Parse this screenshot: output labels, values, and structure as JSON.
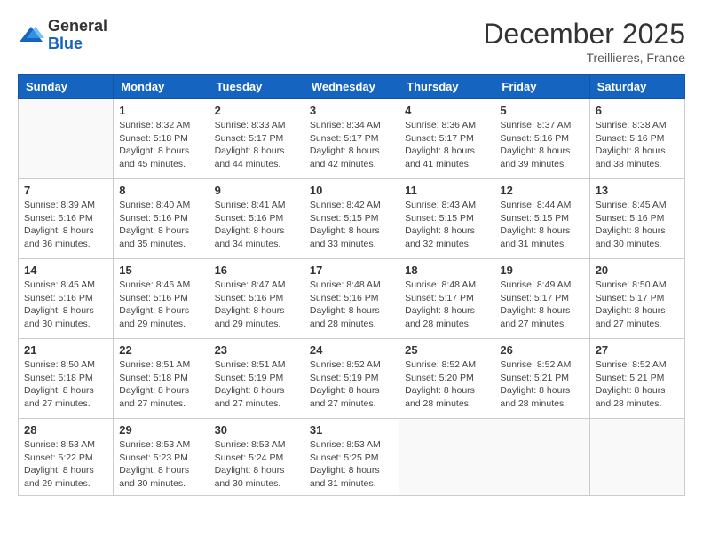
{
  "header": {
    "logo_general": "General",
    "logo_blue": "Blue",
    "month_title": "December 2025",
    "subtitle": "Treillieres, France"
  },
  "days_of_week": [
    "Sunday",
    "Monday",
    "Tuesday",
    "Wednesday",
    "Thursday",
    "Friday",
    "Saturday"
  ],
  "weeks": [
    [
      {
        "day": "",
        "info": ""
      },
      {
        "day": "1",
        "info": "Sunrise: 8:32 AM\nSunset: 5:18 PM\nDaylight: 8 hours\nand 45 minutes."
      },
      {
        "day": "2",
        "info": "Sunrise: 8:33 AM\nSunset: 5:17 PM\nDaylight: 8 hours\nand 44 minutes."
      },
      {
        "day": "3",
        "info": "Sunrise: 8:34 AM\nSunset: 5:17 PM\nDaylight: 8 hours\nand 42 minutes."
      },
      {
        "day": "4",
        "info": "Sunrise: 8:36 AM\nSunset: 5:17 PM\nDaylight: 8 hours\nand 41 minutes."
      },
      {
        "day": "5",
        "info": "Sunrise: 8:37 AM\nSunset: 5:16 PM\nDaylight: 8 hours\nand 39 minutes."
      },
      {
        "day": "6",
        "info": "Sunrise: 8:38 AM\nSunset: 5:16 PM\nDaylight: 8 hours\nand 38 minutes."
      }
    ],
    [
      {
        "day": "7",
        "info": "Sunrise: 8:39 AM\nSunset: 5:16 PM\nDaylight: 8 hours\nand 36 minutes."
      },
      {
        "day": "8",
        "info": "Sunrise: 8:40 AM\nSunset: 5:16 PM\nDaylight: 8 hours\nand 35 minutes."
      },
      {
        "day": "9",
        "info": "Sunrise: 8:41 AM\nSunset: 5:16 PM\nDaylight: 8 hours\nand 34 minutes."
      },
      {
        "day": "10",
        "info": "Sunrise: 8:42 AM\nSunset: 5:15 PM\nDaylight: 8 hours\nand 33 minutes."
      },
      {
        "day": "11",
        "info": "Sunrise: 8:43 AM\nSunset: 5:15 PM\nDaylight: 8 hours\nand 32 minutes."
      },
      {
        "day": "12",
        "info": "Sunrise: 8:44 AM\nSunset: 5:15 PM\nDaylight: 8 hours\nand 31 minutes."
      },
      {
        "day": "13",
        "info": "Sunrise: 8:45 AM\nSunset: 5:16 PM\nDaylight: 8 hours\nand 30 minutes."
      }
    ],
    [
      {
        "day": "14",
        "info": "Sunrise: 8:45 AM\nSunset: 5:16 PM\nDaylight: 8 hours\nand 30 minutes."
      },
      {
        "day": "15",
        "info": "Sunrise: 8:46 AM\nSunset: 5:16 PM\nDaylight: 8 hours\nand 29 minutes."
      },
      {
        "day": "16",
        "info": "Sunrise: 8:47 AM\nSunset: 5:16 PM\nDaylight: 8 hours\nand 29 minutes."
      },
      {
        "day": "17",
        "info": "Sunrise: 8:48 AM\nSunset: 5:16 PM\nDaylight: 8 hours\nand 28 minutes."
      },
      {
        "day": "18",
        "info": "Sunrise: 8:48 AM\nSunset: 5:17 PM\nDaylight: 8 hours\nand 28 minutes."
      },
      {
        "day": "19",
        "info": "Sunrise: 8:49 AM\nSunset: 5:17 PM\nDaylight: 8 hours\nand 27 minutes."
      },
      {
        "day": "20",
        "info": "Sunrise: 8:50 AM\nSunset: 5:17 PM\nDaylight: 8 hours\nand 27 minutes."
      }
    ],
    [
      {
        "day": "21",
        "info": "Sunrise: 8:50 AM\nSunset: 5:18 PM\nDaylight: 8 hours\nand 27 minutes."
      },
      {
        "day": "22",
        "info": "Sunrise: 8:51 AM\nSunset: 5:18 PM\nDaylight: 8 hours\nand 27 minutes."
      },
      {
        "day": "23",
        "info": "Sunrise: 8:51 AM\nSunset: 5:19 PM\nDaylight: 8 hours\nand 27 minutes."
      },
      {
        "day": "24",
        "info": "Sunrise: 8:52 AM\nSunset: 5:19 PM\nDaylight: 8 hours\nand 27 minutes."
      },
      {
        "day": "25",
        "info": "Sunrise: 8:52 AM\nSunset: 5:20 PM\nDaylight: 8 hours\nand 28 minutes."
      },
      {
        "day": "26",
        "info": "Sunrise: 8:52 AM\nSunset: 5:21 PM\nDaylight: 8 hours\nand 28 minutes."
      },
      {
        "day": "27",
        "info": "Sunrise: 8:52 AM\nSunset: 5:21 PM\nDaylight: 8 hours\nand 28 minutes."
      }
    ],
    [
      {
        "day": "28",
        "info": "Sunrise: 8:53 AM\nSunset: 5:22 PM\nDaylight: 8 hours\nand 29 minutes."
      },
      {
        "day": "29",
        "info": "Sunrise: 8:53 AM\nSunset: 5:23 PM\nDaylight: 8 hours\nand 30 minutes."
      },
      {
        "day": "30",
        "info": "Sunrise: 8:53 AM\nSunset: 5:24 PM\nDaylight: 8 hours\nand 30 minutes."
      },
      {
        "day": "31",
        "info": "Sunrise: 8:53 AM\nSunset: 5:25 PM\nDaylight: 8 hours\nand 31 minutes."
      },
      {
        "day": "",
        "info": ""
      },
      {
        "day": "",
        "info": ""
      },
      {
        "day": "",
        "info": ""
      }
    ]
  ]
}
